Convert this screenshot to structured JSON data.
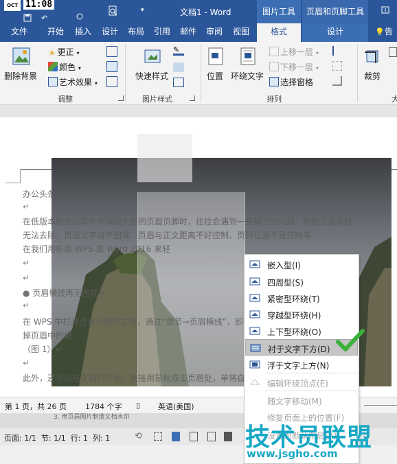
{
  "window": {
    "title": "文档1 - Word",
    "clock": "11:08",
    "clock_prefix": "OCT",
    "context_tab_picture_tools": "图片工具",
    "context_tab_header_footer_tools": "页眉和页脚工具",
    "tell_me": "告"
  },
  "tabs": [
    "文件",
    "开始",
    "插入",
    "设计",
    "布局",
    "引用",
    "邮件",
    "审阅",
    "视图",
    "格式",
    "设计"
  ],
  "active_tab": "格式",
  "ribbon": {
    "remove_bg": "删除背景",
    "corrections": "更正",
    "color": "颜色",
    "artistic": "艺术效果",
    "group_adjust": "调整",
    "quick_styles": "快速样式",
    "group_picture_styles": "图片样式",
    "position": "位置",
    "wrap_text": "环绕文字",
    "bring_forward": "上移一层",
    "send_backward": "下移一层",
    "selection_pane": "选择窗格",
    "group_arrange": "排列",
    "crop": "裁剪",
    "size_trunc": "大"
  },
  "document": {
    "lines": [
      "办公头条：轻松解决页眉页",
      "↵",
      "在低版本的办公软件中编辑文档的页眉页脚时，往往会遇到一些棘手的问题，例如页眉横线",
      "无法去除、页眉文字对齐困难、页眉与正文距离不好控制、页码位置不易控制等",
      "在我们用新版 WPS 或 Word 2016 来轻",
      "↵",
      "↵",
      "●  页眉横线再无困扰↵",
      "↵",
      "在 WPS 中打开含有页眉的文档，通过“章节→页眉横线”，即可去",
      "掉页眉中的横",
      "（图 1）↵",
      "↵",
      "此外，还可以在文档打开后，直接用鼠标双击页眉处，单将自动开"
    ]
  },
  "statusbar": {
    "page": "第 1 页，共 26 页",
    "words": "1784 个字",
    "language": "英语(美国)"
  },
  "inner_window": {
    "caption": "3. 用页眉图片制造文档水印",
    "status": "页面: 1/1  节: 1/1  行: 1  列: 1"
  },
  "wrap_menu": {
    "items": [
      {
        "label": "嵌入型(I)",
        "disabled": false,
        "highlighted": false,
        "icon": "inline-wrap-icon"
      },
      {
        "label": "四周型(S)",
        "disabled": false,
        "highlighted": false,
        "icon": "square-wrap-icon"
      },
      {
        "label": "紧密型环绕(T)",
        "disabled": false,
        "highlighted": false,
        "icon": "tight-wrap-icon"
      },
      {
        "label": "穿越型环绕(H)",
        "disabled": false,
        "highlighted": false,
        "icon": "through-wrap-icon"
      },
      {
        "label": "上下型环绕(O)",
        "disabled": false,
        "highlighted": false,
        "icon": "top-bottom-wrap-icon"
      },
      {
        "label": "衬于文字下方(D)",
        "disabled": false,
        "highlighted": true,
        "icon": "behind-text-icon"
      },
      {
        "label": "浮于文字上方(N)",
        "disabled": false,
        "highlighted": false,
        "icon": "in-front-text-icon"
      },
      {
        "label": "编辑环绕顶点(E)",
        "disabled": true,
        "highlighted": false,
        "icon": "edit-wrap-points-icon"
      },
      {
        "label": "随文字移动(M)",
        "disabled": true,
        "highlighted": false,
        "icon": ""
      },
      {
        "label": "修复页面上的位置(F)",
        "disabled": true,
        "highlighted": false,
        "icon": ""
      },
      {
        "label": "设置为默认布局(A)",
        "disabled": true,
        "highlighted": false,
        "icon": ""
      }
    ]
  },
  "watermark": {
    "text": "技术员联盟",
    "url": "www.jsgho.com"
  },
  "colors": {
    "brand": "#2b579a",
    "check": "#3bb03b",
    "watermark": "#17a8c6"
  }
}
